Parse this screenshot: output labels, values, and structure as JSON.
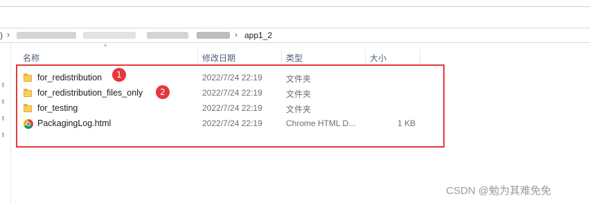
{
  "address_bar": {
    "edge_glyph": ")",
    "separator": "›",
    "current_folder": "app1_2"
  },
  "columns": {
    "name": "名称",
    "date": "修改日期",
    "type": "类型",
    "size": "大小"
  },
  "sort_indicator": "^",
  "files": [
    {
      "name": "for_redistribution",
      "date": "2022/7/24 22:19",
      "type": "文件夹",
      "size": "",
      "icon": "folder-icon"
    },
    {
      "name": "for_redistribution_files_only",
      "date": "2022/7/24 22:19",
      "type": "文件夹",
      "size": "",
      "icon": "folder-icon"
    },
    {
      "name": "for_testing",
      "date": "2022/7/24 22:19",
      "type": "文件夹",
      "size": "",
      "icon": "folder-icon"
    },
    {
      "name": "PackagingLog.html",
      "date": "2022/7/24 22:19",
      "type": "Chrome HTML D...",
      "size": "1 KB",
      "icon": "chrome-icon"
    }
  ],
  "annotations": [
    {
      "label": "1"
    },
    {
      "label": "2"
    }
  ],
  "watermark": "CSDN @勉为其难免免",
  "colors": {
    "highlight": "#e5383b",
    "header_text": "#4c607a"
  }
}
